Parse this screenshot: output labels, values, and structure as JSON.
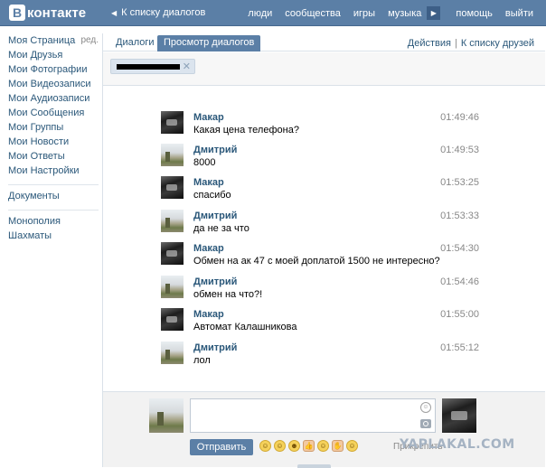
{
  "header": {
    "logo_letter": "В",
    "logo_text": "контакте",
    "back_label": "К списку диалогов",
    "nav": [
      "люди",
      "сообщества",
      "игры",
      "музыка",
      "помощь",
      "выйти"
    ]
  },
  "sidebar": {
    "edit_label": "ред.",
    "items": [
      "Моя Страница",
      "Мои Друзья",
      "Мои Фотографии",
      "Мои Видеозаписи",
      "Мои Аудиозаписи",
      "Мои Сообщения",
      "Мои Группы",
      "Мои Новости",
      "Мои Ответы",
      "Мои Настройки"
    ],
    "group2": [
      "Документы"
    ],
    "group3": [
      "Монополия",
      "Шахматы"
    ]
  },
  "tabs": {
    "dialogs": "Диалоги",
    "view": "Просмотр диалогов",
    "actions": "Действия",
    "friends_list": "К списку друзей"
  },
  "messages": [
    {
      "author": "Макар",
      "text": "Какая цена телефона?",
      "time": "01:49:46",
      "avatar": "makar"
    },
    {
      "author": "Дмитрий",
      "text": "8000",
      "time": "01:49:53",
      "avatar": "dmitry"
    },
    {
      "author": "Макар",
      "text": "спасибо",
      "time": "01:53:25",
      "avatar": "makar"
    },
    {
      "author": "Дмитрий",
      "text": "да не за что",
      "time": "01:53:33",
      "avatar": "dmitry"
    },
    {
      "author": "Макар",
      "text": "Обмен на ак 47 с моей доплатой 1500 не интересно?",
      "time": "01:54:30",
      "avatar": "makar"
    },
    {
      "author": "Дмитрий",
      "text": "обмен на что?!",
      "time": "01:54:46",
      "avatar": "dmitry"
    },
    {
      "author": "Макар",
      "text": "Автомат Калашникова",
      "time": "01:55:00",
      "avatar": "makar"
    },
    {
      "author": "Дмитрий",
      "text": "лол",
      "time": "01:55:12",
      "avatar": "dmitry"
    }
  ],
  "compose": {
    "send_label": "Отправить",
    "attach_label": "Прикрепить",
    "emojis": [
      "☺",
      "☺",
      "☻",
      "👍",
      "☺",
      "✋",
      "☺"
    ]
  },
  "watermark": "YAPLAKAL.COM",
  "colors": {
    "header_blue": "#5b7fa6",
    "link_blue": "#2b587a",
    "muted_gray": "#888888"
  }
}
